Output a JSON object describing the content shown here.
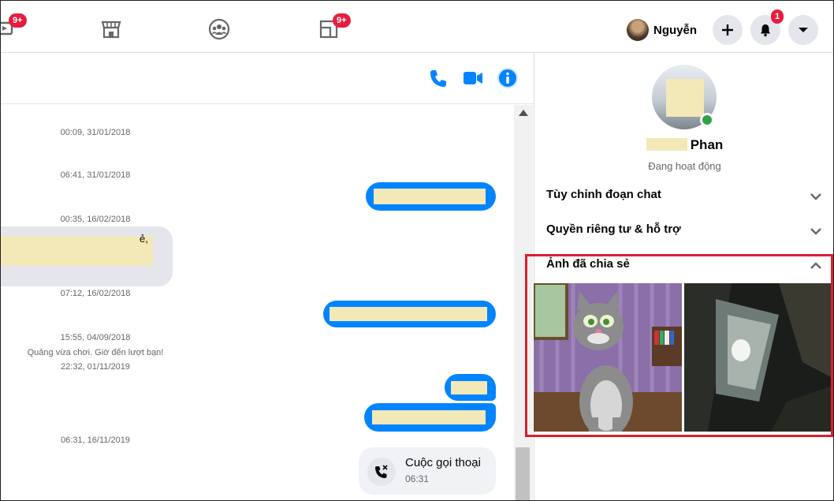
{
  "topbar": {
    "watch_badge": "9+",
    "gaming_badge": "9+",
    "profile_name": "Nguyễn",
    "notifications_badge": "1"
  },
  "chat": {
    "timestamps": [
      "00:09, 31/01/2018",
      "06:41, 31/01/2018",
      "00:35, 16/02/2018",
      "07:12, 16/02/2018",
      "15:55, 04/09/2018",
      "Quảng vừa chơi. Giờ đến lượt bạn!",
      "22:32, 01/11/2019",
      "06:31, 16/11/2019"
    ],
    "incoming_fragment": "ẻ,",
    "call": {
      "title": "Cuộc gọi thoại",
      "duration": "06:31"
    }
  },
  "right_panel": {
    "contact_last_name": "Phan",
    "status": "Đang hoạt động",
    "sections": [
      {
        "label": "Tùy chỉnh đoạn chat",
        "state": "collapsed"
      },
      {
        "label": "Quyền riêng tư & hỗ trợ",
        "state": "collapsed"
      },
      {
        "label": "Ảnh đã chia sẻ",
        "state": "expanded"
      }
    ]
  },
  "colors": {
    "messenger_blue": "#0084ff",
    "badge_red": "#e41e3f",
    "online_green": "#31a24c",
    "highlight_red": "#d9202e"
  }
}
